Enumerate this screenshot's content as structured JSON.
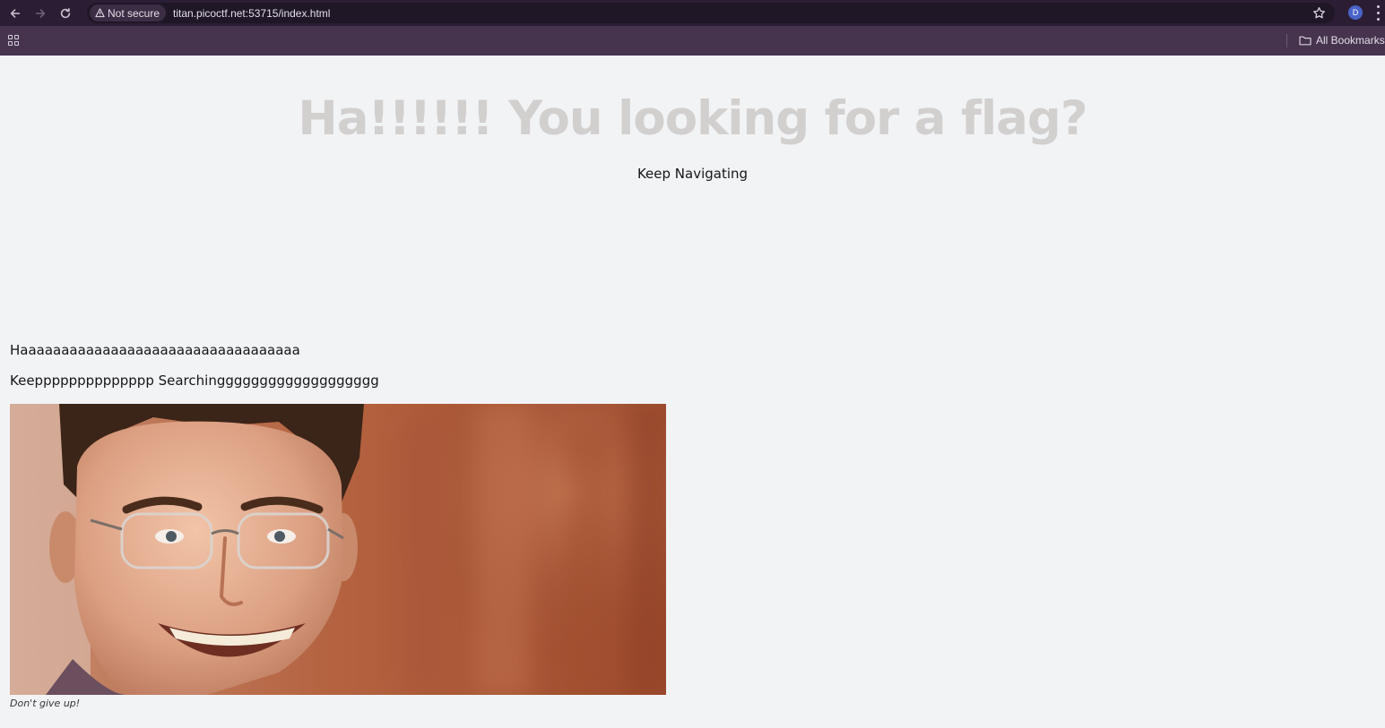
{
  "browser": {
    "security_label": "Not secure",
    "url": "titan.picoctf.net:53715/index.html",
    "profile_initial": "D",
    "bookmarks_label": "All Bookmarks"
  },
  "page": {
    "heading": "Ha!!!!!! You looking for a flag?",
    "subheading": "Keep Navigating",
    "paragraph1": "Haaaaaaaaaaaaaaaaaaaaaaaaaaaaaaaaaa",
    "paragraph2": "Keepppppppppppppp Searchinggggggggggggggggggg",
    "image_caption": "Don't give up!"
  }
}
